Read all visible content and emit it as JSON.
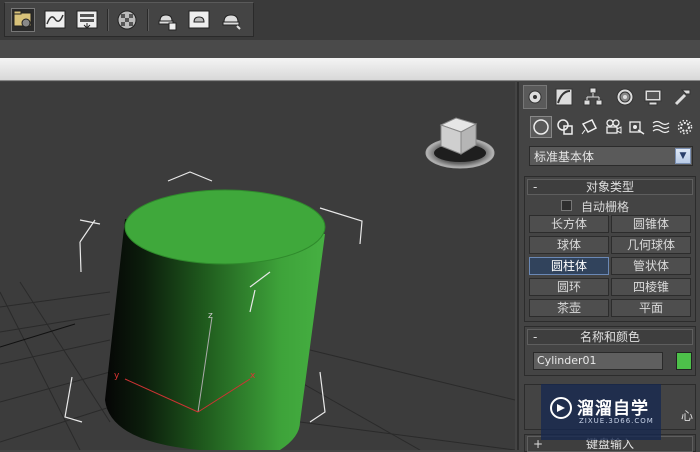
{
  "toolbar": {
    "buttons": [
      {
        "icon": "scene-explorer-icon",
        "active": true
      },
      {
        "icon": "curve-editor-icon"
      },
      {
        "icon": "schematic-view-icon"
      },
      {
        "icon": "material-editor-icon"
      },
      {
        "icon": "render-setup-icon"
      },
      {
        "icon": "rendered-frame-window-icon"
      },
      {
        "icon": "render-production-icon"
      }
    ]
  },
  "viewport": {
    "axis_labels": {
      "z": "z",
      "x": "x",
      "y": "y"
    },
    "cylinder_color": "#3fa83b"
  },
  "command_panel": {
    "tabs": [
      "create-tab",
      "modify-tab",
      "hierarchy-tab",
      "motion-tab",
      "display-tab",
      "utilities-tab"
    ],
    "categories": [
      "geometry",
      "shapes",
      "lights",
      "cameras",
      "helpers",
      "space-warps",
      "systems"
    ],
    "dropdown_value": "标准基本体",
    "object_type": {
      "title": "对象类型",
      "collapse_sign": "-",
      "autogrid_label": "自动栅格",
      "buttons": [
        "长方体",
        "圆锥体",
        "球体",
        "几何球体",
        "圆柱体",
        "管状体",
        "圆环",
        "四棱锥",
        "茶壶",
        "平面"
      ],
      "active": "圆柱体"
    },
    "name_color": {
      "title": "名称和颜色",
      "collapse_sign": "-",
      "name_value": "Cylinder01",
      "color": "#4dc04a"
    },
    "keyboard_entry": {
      "title": "键盘输入",
      "collapse_sign": "+"
    },
    "partial_text": "心"
  },
  "watermark": {
    "title": "溜溜自学",
    "subtitle": "ZIXUE.3D66.COM"
  }
}
